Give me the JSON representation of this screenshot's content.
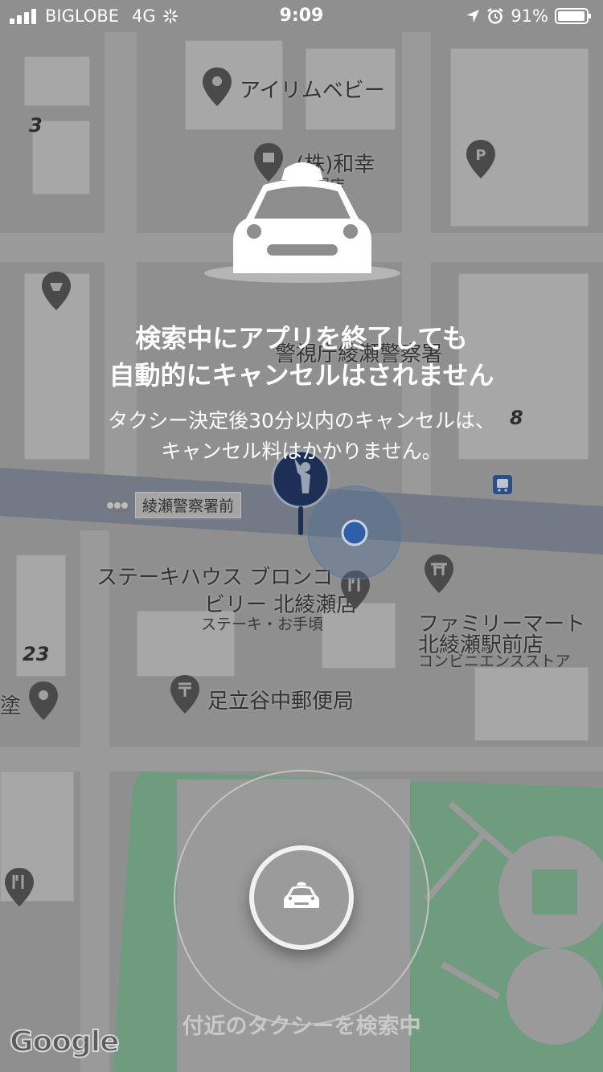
{
  "status_bar": {
    "carrier": "BIGLOBE",
    "network": "4G",
    "time": "9:09",
    "battery": "91%",
    "icons": [
      "signal-icon",
      "loading-icon",
      "location-arrow-icon",
      "alarm-icon",
      "battery-icon"
    ]
  },
  "map": {
    "labels": {
      "airimubebi": "アイリムベビー",
      "wakou": "(株)和幸",
      "wakou_sub": "呉服店",
      "police": "警視庁綾瀬警察署",
      "signal_name": "綾瀬警察署前",
      "steak_line1": "ステーキハウス ブロンコ",
      "steak_line2": "ビリー 北綾瀬店",
      "steak_sub": "ステーキ・お手頃",
      "familymart_line1": "ファミリーマート",
      "familymart_line2": "北綾瀬駅前店",
      "familymart_sub": "コンビニエンスストア",
      "post_office": "足立谷中郵便局",
      "left_edge": "塗",
      "num_3": "3",
      "num_8": "8",
      "num_23": "23"
    },
    "pin_icons": [
      "location-pin-icon",
      "shopping-pin-icon",
      "parking-pin-icon",
      "pharmacy-pin-icon",
      "restaurant-pin-icon",
      "shrine-pin-icon",
      "post-office-pin-icon",
      "bus-stop-icon"
    ]
  },
  "overlay": {
    "title_line1": "検索中にアプリを終了しても",
    "title_line2": "自動的にキャンセルはされません",
    "subtitle_line1": "タクシー決定後30分以内のキャンセルは、",
    "subtitle_line2": "キャンセル料はかかりません。",
    "search_status": "付近のタクシーを検索中"
  },
  "google_logo": "Google",
  "colors": {
    "overlay_dim": "#8d8d8d",
    "user_location": "#2f5fa8",
    "pickup_pin": "#1e2f55",
    "park": "#6f9b7f"
  }
}
